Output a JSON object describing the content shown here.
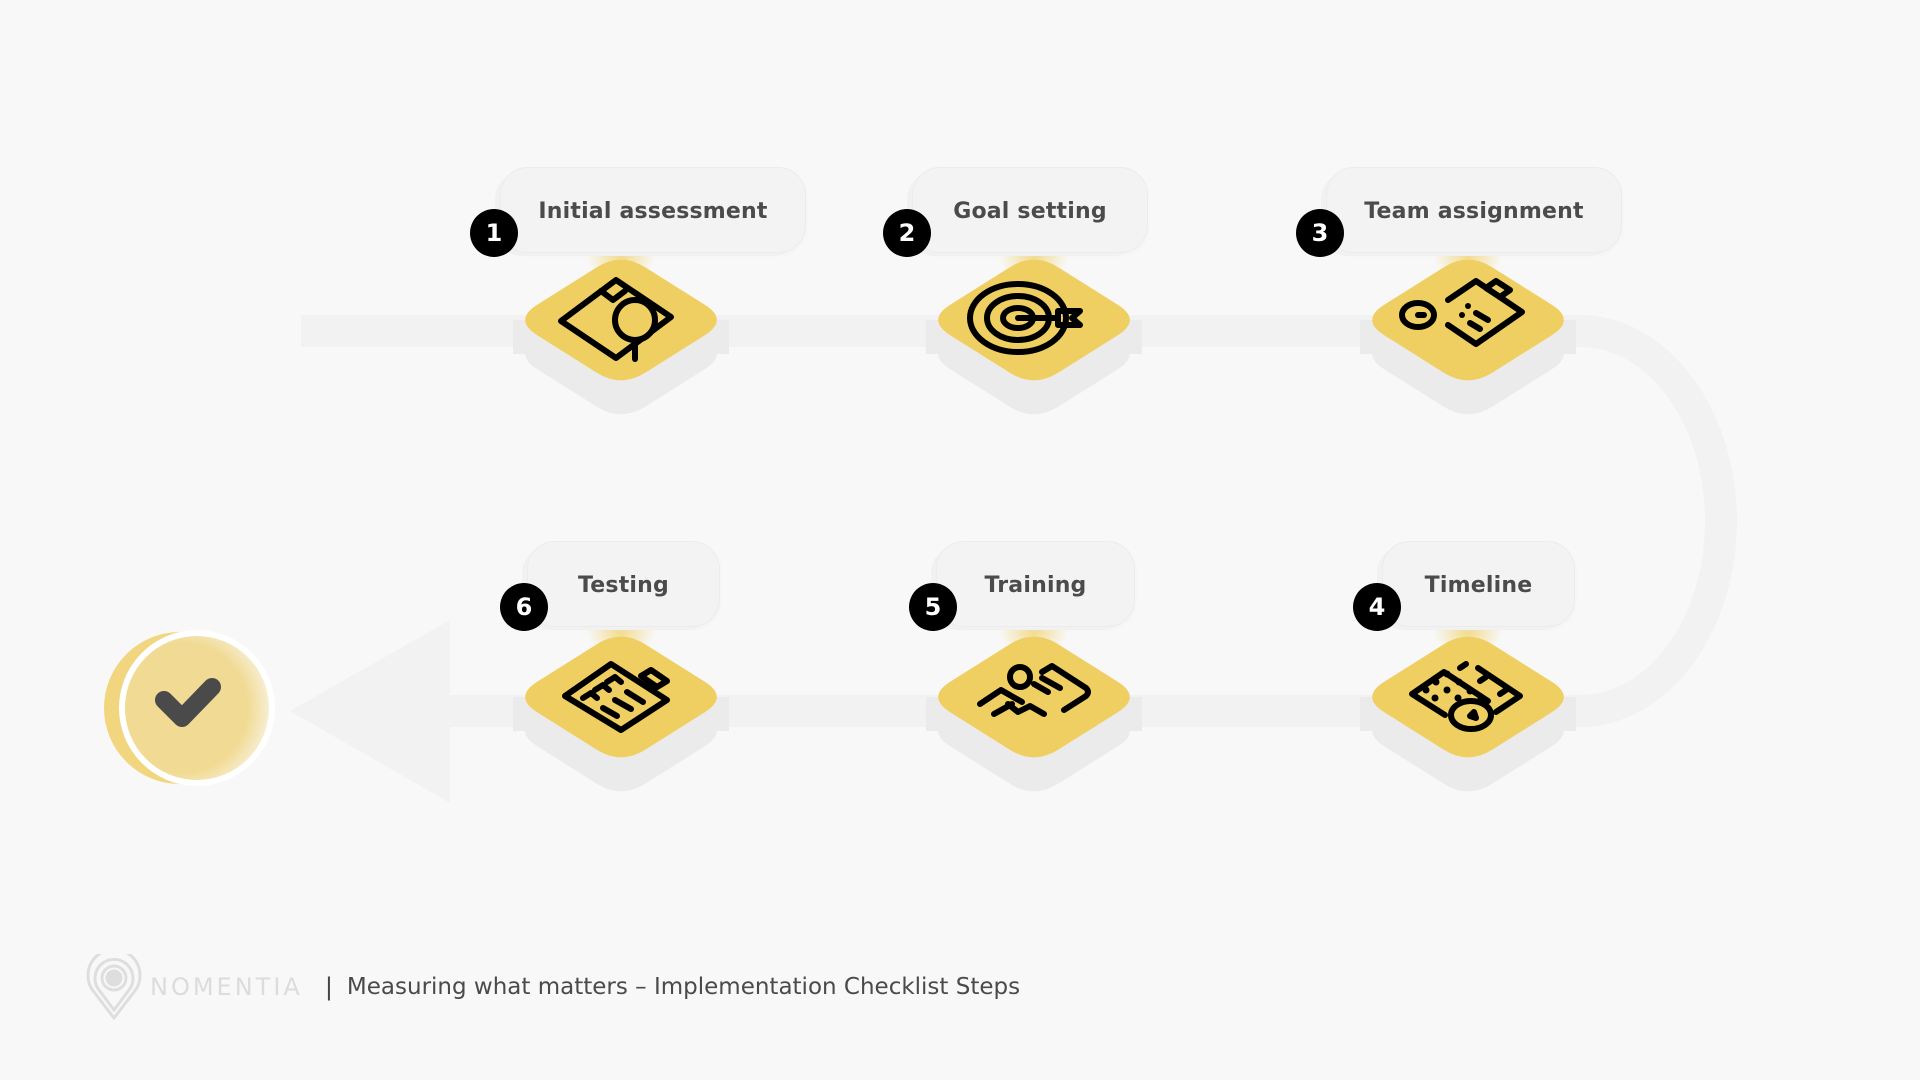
{
  "diagram": {
    "type": "process-flow",
    "colors": {
      "background": "#f8f8f8",
      "connector": "#f2f2f2",
      "tile_top": "#f0cf62",
      "tile_base": "#ebebeb",
      "badge": "#000000",
      "label_text": "#4b4b4b",
      "check_disc": "#f1da93",
      "check_mark": "#4a4a4a"
    },
    "steps": [
      {
        "number": "1",
        "label": "Initial assessment",
        "icon": "document-search-icon"
      },
      {
        "number": "2",
        "label": "Goal setting",
        "icon": "target-arrow-icon"
      },
      {
        "number": "3",
        "label": "Team assignment",
        "icon": "clipboard-clock-icon"
      },
      {
        "number": "4",
        "label": "Timeline",
        "icon": "calendar-clock-icon"
      },
      {
        "number": "5",
        "label": "Training",
        "icon": "presentation-teacher-icon"
      },
      {
        "number": "6",
        "label": "Testing",
        "icon": "checklist-clipboard-icon"
      }
    ],
    "end_marker": {
      "icon": "checkmark-icon"
    }
  },
  "footer": {
    "brand": "NOMENTIA",
    "separator": "|",
    "caption": "Measuring what matters – Implementation Checklist Steps",
    "logo_icon": "location-pin-logo-icon"
  }
}
